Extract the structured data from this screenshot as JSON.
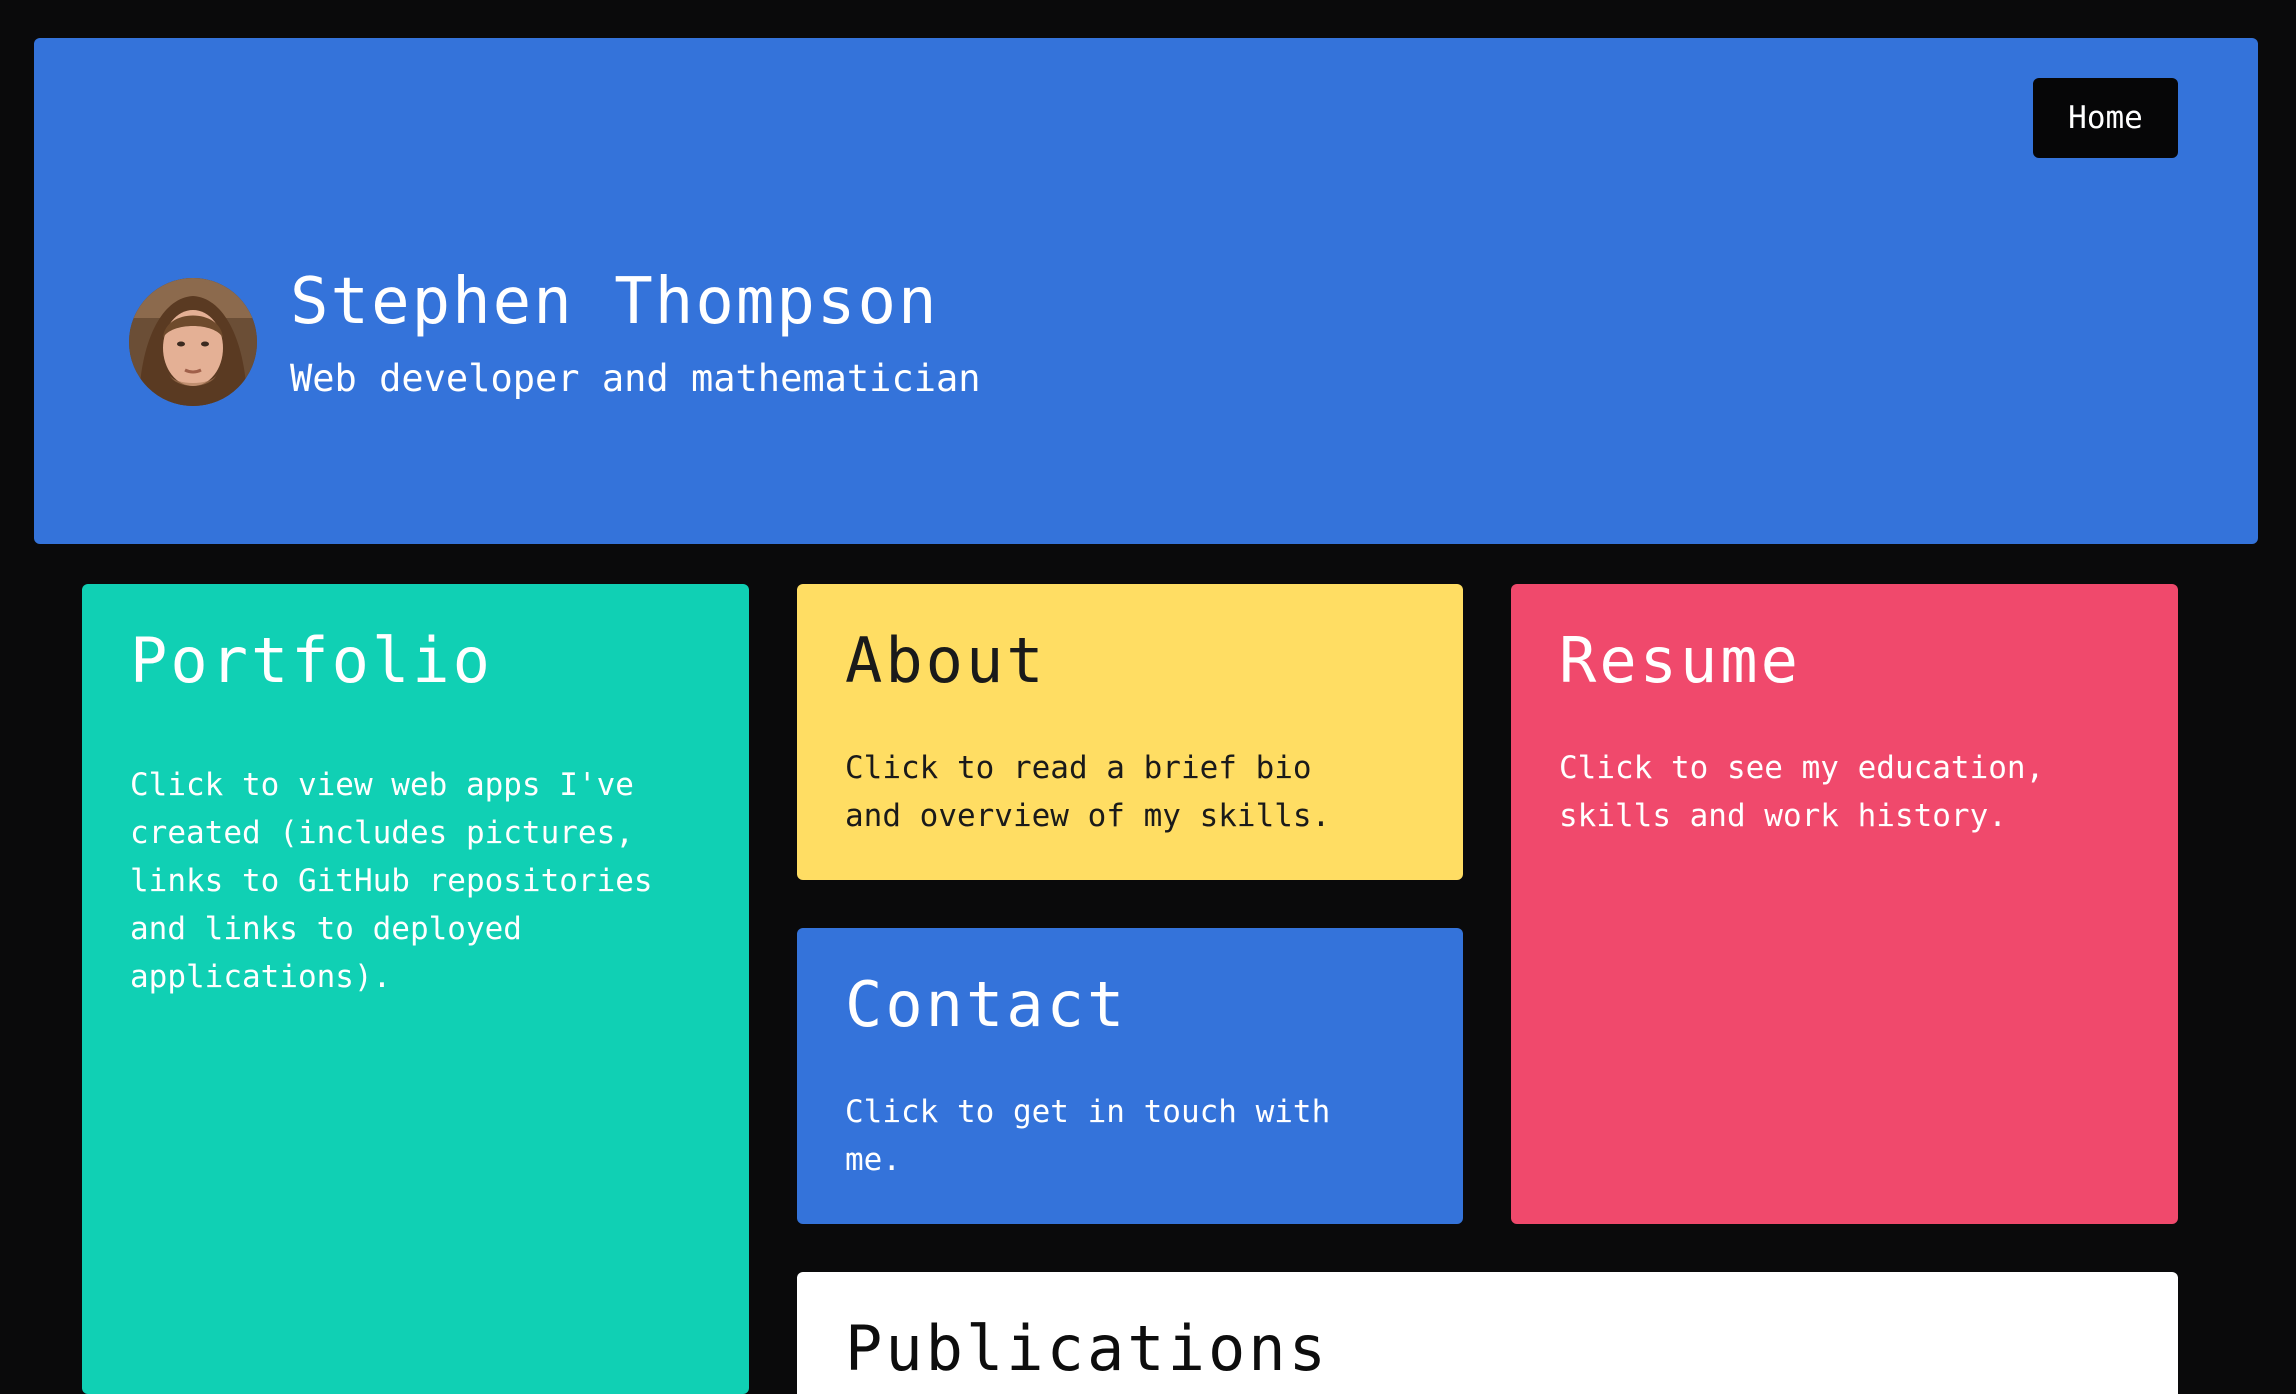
{
  "header": {
    "home_label": "Home",
    "name": "Stephen Thompson",
    "tagline": "Web developer and mathematician"
  },
  "cards": {
    "portfolio": {
      "title": "Portfolio",
      "lines": [
        "Click to view web apps I've",
        "created (includes pictures,",
        "links to GitHub repositories",
        "and links to deployed",
        "applications)."
      ]
    },
    "about": {
      "title": "About",
      "lines": [
        "Click to read a brief bio",
        "and overview of my skills."
      ]
    },
    "resume": {
      "title": "Resume",
      "lines": [
        "Click to see my education,",
        "skills and work history."
      ]
    },
    "contact": {
      "title": "Contact",
      "lines": [
        "Click to get in touch with",
        "me."
      ]
    },
    "publications": {
      "title": "Publications"
    }
  },
  "colors": {
    "background": "#0a0a0b",
    "hero": "#3473da",
    "portfolio": "#10d0b4",
    "about": "#ffdd63",
    "resume": "#f0496c",
    "contact": "#3473da",
    "publications": "#ffffff"
  }
}
